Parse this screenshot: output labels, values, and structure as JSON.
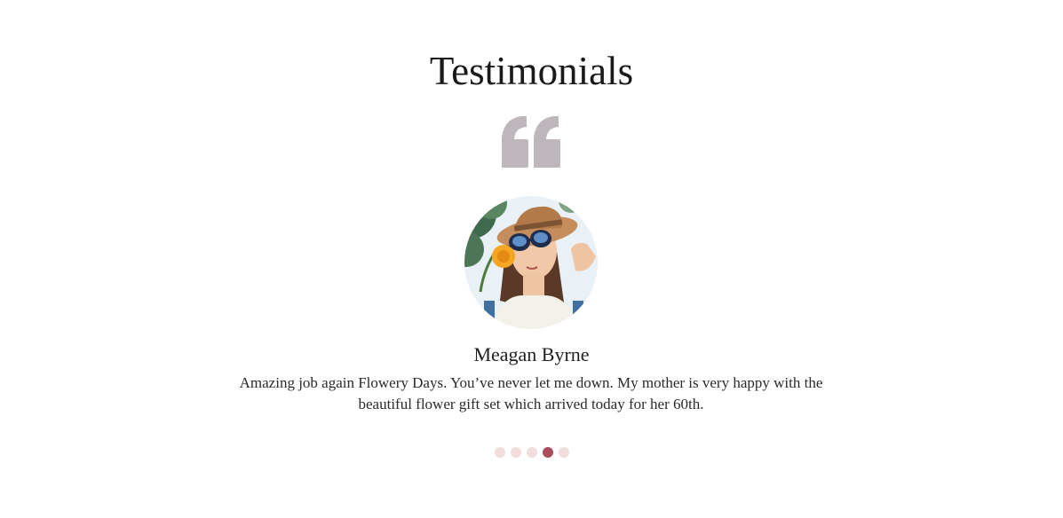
{
  "testimonials": {
    "heading": "Testimonials",
    "quote_icon": "quote-icon",
    "current": {
      "name": "Meagan Byrne",
      "text": "Amazing job again Flowery Days. You’ve never let me down. My mother is very happy with the beautiful flower gift set which arrived today for her 60th.",
      "avatar_description": "woman-with-hat-and-sunglasses-smelling-flower"
    },
    "pagination": {
      "total": 5,
      "active_index": 3
    }
  },
  "colors": {
    "quote_icon": "#bdb6bc",
    "dot_inactive": "#f2dcdc",
    "dot_active": "#a84e5a"
  }
}
